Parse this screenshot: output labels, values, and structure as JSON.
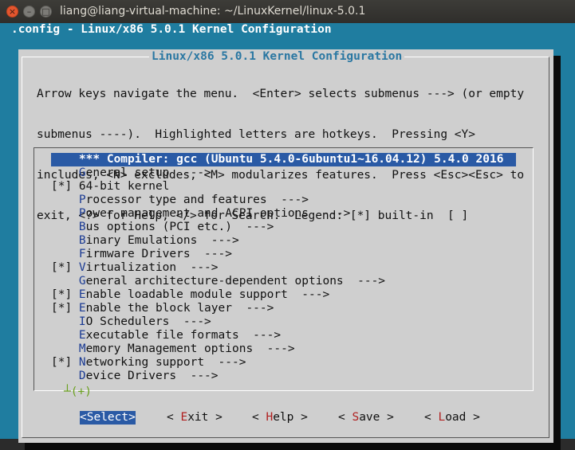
{
  "window": {
    "title": "liang@liang-virtual-machine: ~/LinuxKernel/linux-5.0.1",
    "close_glyph": "×",
    "min_glyph": "–",
    "max_glyph": "□"
  },
  "terminal": {
    "header": ".config - Linux/x86 5.0.1 Kernel Configuration",
    "dialog_title": "Linux/x86 5.0.1 Kernel Configuration",
    "help_lines": [
      "Arrow keys navigate the menu.  <Enter> selects submenus ---> (or empty",
      "submenus ----).  Highlighted letters are hotkeys.  Pressing <Y>",
      "includes, <N> excludes, <M> modularizes features.  Press <Esc><Esc> to",
      "exit, <?> for Help, </> for Search.  Legend: [*] built-in  [ ]"
    ],
    "menu_items": [
      {
        "prefix": "    ",
        "hot": "",
        "rest": "*** Compiler: gcc (Ubuntu 5.4.0-6ubuntu1~16.04.12) 5.4.0 2016",
        "selected": true
      },
      {
        "prefix": "    ",
        "hot": "G",
        "rest": "eneral setup  --->",
        "selected": false
      },
      {
        "prefix": "[*] ",
        "hot": "",
        "rest": "64-bit kernel",
        "selected": false
      },
      {
        "prefix": "    ",
        "hot": "P",
        "rest": "rocessor type and features  --->",
        "selected": false
      },
      {
        "prefix": "    ",
        "hot": "P",
        "rest": "ower management and ACPI options  --->",
        "selected": false
      },
      {
        "prefix": "    ",
        "hot": "B",
        "rest": "us options (PCI etc.)  --->",
        "selected": false
      },
      {
        "prefix": "    ",
        "hot": "B",
        "rest": "inary Emulations  --->",
        "selected": false
      },
      {
        "prefix": "    ",
        "hot": "F",
        "rest": "irmware Drivers  --->",
        "selected": false
      },
      {
        "prefix": "[*] ",
        "hot": "V",
        "rest": "irtualization  --->",
        "selected": false
      },
      {
        "prefix": "    ",
        "hot": "G",
        "rest": "eneral architecture-dependent options  --->",
        "selected": false
      },
      {
        "prefix": "[*] ",
        "hot": "E",
        "rest": "nable loadable module support  --->",
        "selected": false
      },
      {
        "prefix": "[*] ",
        "hot": "E",
        "rest": "nable the block layer  --->",
        "selected": false
      },
      {
        "prefix": "    ",
        "hot": "I",
        "rest": "O Schedulers  --->",
        "selected": false
      },
      {
        "prefix": "    ",
        "hot": "E",
        "rest": "xecutable file formats  --->",
        "selected": false
      },
      {
        "prefix": "    ",
        "hot": "M",
        "rest": "emory Management options  --->",
        "selected": false
      },
      {
        "prefix": "[*] ",
        "hot": "N",
        "rest": "etworking support  --->",
        "selected": false
      },
      {
        "prefix": "    ",
        "hot": "D",
        "rest": "evice Drivers  --->",
        "selected": false
      }
    ],
    "more_indicator": "┴(+)",
    "buttons": [
      {
        "pre": "<",
        "hot": "S",
        "rest": "elect>",
        "selected": true
      },
      {
        "pre": "< ",
        "hot": "E",
        "rest": "xit >",
        "selected": false
      },
      {
        "pre": "< ",
        "hot": "H",
        "rest": "elp >",
        "selected": false
      },
      {
        "pre": "< ",
        "hot": "S",
        "rest": "ave >",
        "selected": false
      },
      {
        "pre": "< ",
        "hot": "L",
        "rest": "oad >",
        "selected": false
      }
    ]
  }
}
